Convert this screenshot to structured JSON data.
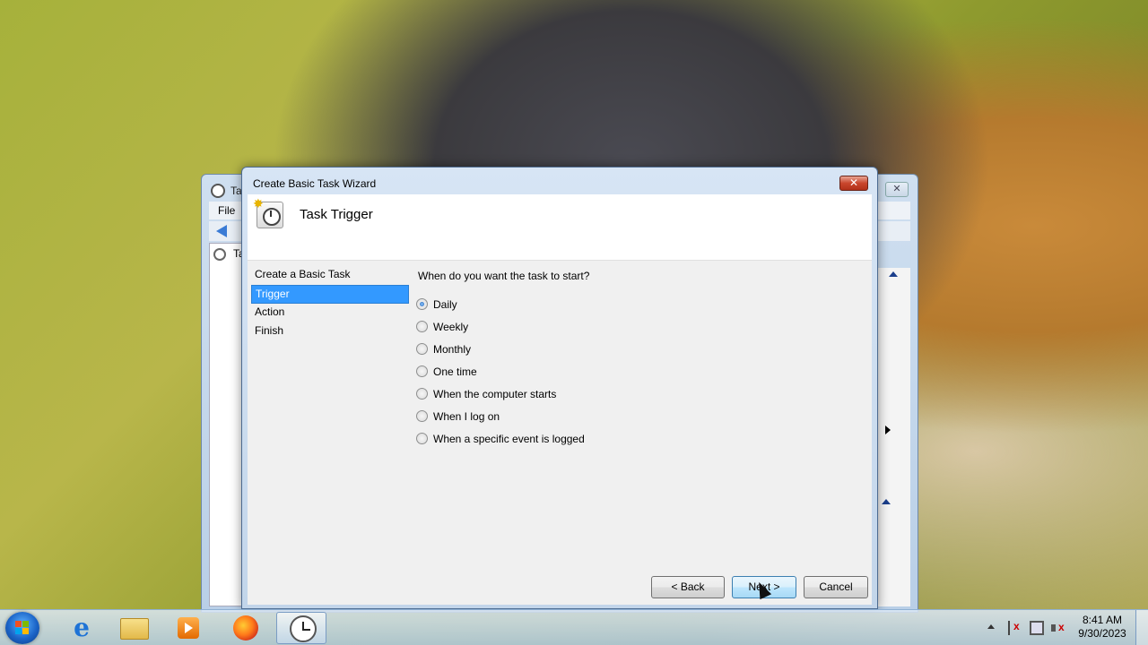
{
  "background_window": {
    "title": "Ta",
    "menu_file": "File",
    "tree_item": "Ta"
  },
  "wizard": {
    "title": "Create Basic Task Wizard",
    "close_label": "✕",
    "heading": "Task Trigger",
    "nav": [
      {
        "label": "Create a Basic Task",
        "selected": false
      },
      {
        "label": "Trigger",
        "selected": true
      },
      {
        "label": "Action",
        "selected": false
      },
      {
        "label": "Finish",
        "selected": false
      }
    ],
    "question": "When do you want the task to start?",
    "options": [
      {
        "label": "Daily",
        "checked": true
      },
      {
        "label": "Weekly",
        "checked": false
      },
      {
        "label": "Monthly",
        "checked": false
      },
      {
        "label": "One time",
        "checked": false
      },
      {
        "label": "When the computer starts",
        "checked": false
      },
      {
        "label": "When I log on",
        "checked": false
      },
      {
        "label": "When a specific event is logged",
        "checked": false
      }
    ],
    "buttons": {
      "back": "< Back",
      "next": "Next >",
      "cancel": "Cancel"
    }
  },
  "taskbar": {
    "pinned": [
      "internet-explorer",
      "windows-explorer",
      "media-player",
      "firefox",
      "task-scheduler"
    ],
    "clock_time": "8:41 AM",
    "clock_date": "9/30/2023"
  },
  "colors": {
    "selection": "#3399ff",
    "close_button": "#c9462c",
    "taskbar": "#c8dcef"
  }
}
